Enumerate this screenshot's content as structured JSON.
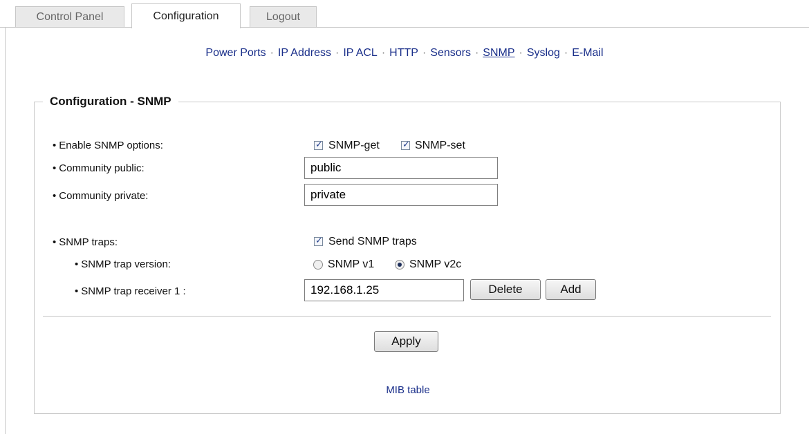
{
  "tabs": {
    "control_panel": "Control Panel",
    "configuration": "Configuration",
    "logout": "Logout"
  },
  "subnav": {
    "items": [
      "Power Ports",
      "IP Address",
      "IP ACL",
      "HTTP",
      "Sensors",
      "SNMP",
      "Syslog",
      "E-Mail"
    ],
    "separator": "·",
    "current": "SNMP"
  },
  "section": {
    "title": "Configuration - SNMP"
  },
  "form": {
    "enable_label": "Enable SNMP options:",
    "snmp_get": {
      "label": "SNMP-get",
      "checked": true
    },
    "snmp_set": {
      "label": "SNMP-set",
      "checked": true
    },
    "community_public_label": "Community public:",
    "community_public_value": "public",
    "community_private_label": "Community private:",
    "community_private_value": "private",
    "traps_label": "SNMP traps:",
    "send_traps": {
      "label": "Send SNMP traps",
      "checked": true
    },
    "trap_version_label": "SNMP trap version:",
    "trap_v1_label": "SNMP v1",
    "trap_v2c_label": "SNMP v2c",
    "trap_version_selected": "SNMP v2c",
    "trap_receiver_label": "SNMP trap receiver 1 :",
    "trap_receiver_value": "192.168.1.25",
    "delete_label": "Delete",
    "add_label": "Add",
    "apply_label": "Apply"
  },
  "footer": {
    "mib_link": "MIB table"
  },
  "colors": {
    "link": "#1a2f8a",
    "border": "#c7c7c7",
    "tab_inactive_bg": "#e9e9e9"
  }
}
